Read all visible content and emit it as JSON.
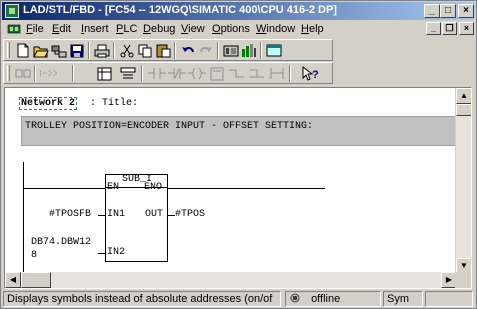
{
  "window": {
    "title": "LAD/STL/FBD - [FC54 -- 12WGQ\\SIMATIC 400\\CPU 416-2 DP]",
    "controls": {
      "minimize": "_",
      "maximize": "□",
      "close": "×"
    }
  },
  "menubar": {
    "items": [
      {
        "label": "File",
        "accel": "F",
        "rest": "ile"
      },
      {
        "label": "Edit",
        "accel": "E",
        "rest": "dit"
      },
      {
        "label": "Insert",
        "accel": "I",
        "rest": "nsert"
      },
      {
        "label": "PLC",
        "accel": "P",
        "rest": "LC"
      },
      {
        "label": "Debug",
        "accel": "D",
        "rest": "ebug"
      },
      {
        "label": "View",
        "accel": "V",
        "rest": "iew"
      },
      {
        "label": "Options",
        "accel": "O",
        "rest": "ptions"
      },
      {
        "label": "Window",
        "accel": "W",
        "rest": "indow"
      },
      {
        "label": "Help",
        "accel": "H",
        "rest": "elp"
      }
    ],
    "doc_controls": {
      "minimize": "_",
      "restore": "❐",
      "close": "×"
    }
  },
  "toolbar1": {
    "icons": [
      "new-icon",
      "open-icon",
      "network-open-icon",
      "save-icon",
      "print-icon",
      "cut-icon",
      "copy-icon",
      "paste-icon",
      "undo-icon",
      "redo-icon",
      "download-icon",
      "monitor-icon",
      "window-icon"
    ]
  },
  "toolbar2": {
    "icons": [
      "overview-icon",
      "insert-network-icon",
      "symbol-table-icon",
      "display-symbols-icon",
      "contact-no-icon",
      "contact-nc-icon",
      "coil-icon",
      "empty-box-icon",
      "open-branch-icon",
      "close-branch-icon",
      "help-pointer-icon"
    ]
  },
  "editor": {
    "network_label": "Network 2",
    "network_title": ": Title:",
    "comment": "TROLLEY POSITION=ENCODER INPUT - OFFSET SETTING:",
    "block": {
      "name": "SUB_I",
      "en": "EN",
      "eno": "ENO",
      "in1_label": "IN1",
      "in1_operand": "#TPOSFB",
      "out_label": "OUT",
      "out_operand": "#TPOS",
      "in2_label": "IN2",
      "in2_operand_line1": "DB74.DBW12",
      "in2_operand_line2": "8"
    }
  },
  "statusbar": {
    "message": "Displays symbols instead of absolute addresses (on/of",
    "mode": "offline",
    "display": "Sym"
  }
}
